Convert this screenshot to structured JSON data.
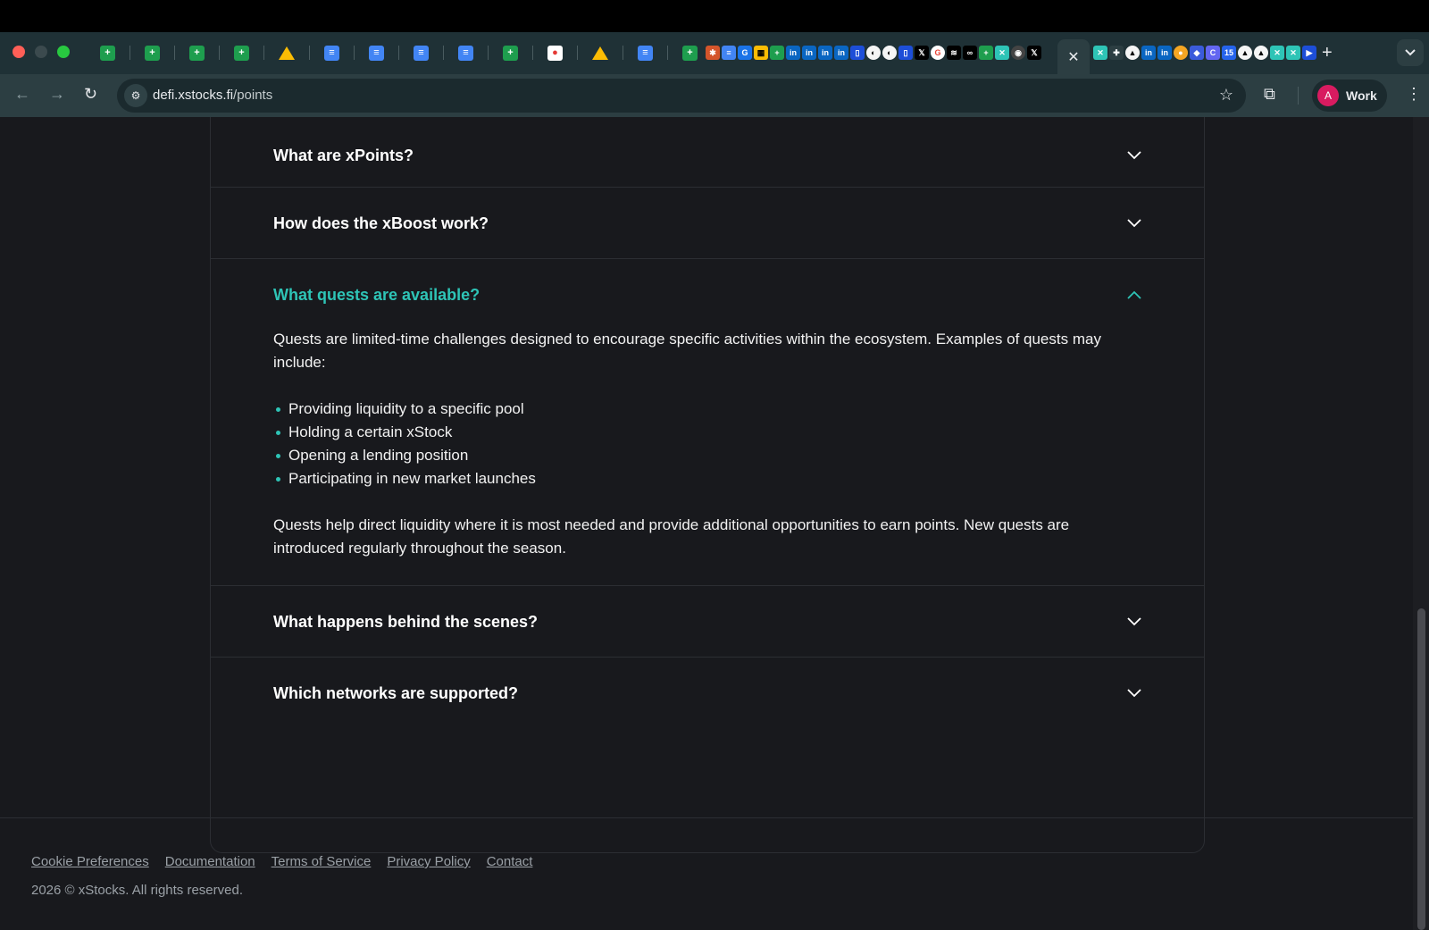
{
  "browser": {
    "active_tab_close": "✕",
    "new_tab": "+",
    "url_host": "defi.xstocks.fi",
    "url_path": "/points",
    "profile_initial": "A",
    "profile_name": "Work",
    "tab_favicons": [
      "sheets",
      "sheets",
      "sheets",
      "sheets",
      "drive",
      "docs",
      "docs",
      "docs",
      "docs",
      "sheets",
      "calendar",
      "drive",
      "docs",
      "sheets"
    ]
  },
  "faq": {
    "items": [
      {
        "question": "What are xPoints?",
        "expanded": false
      },
      {
        "question": "How does the xBoost work?",
        "expanded": false
      },
      {
        "question": "What quests are available?",
        "expanded": true,
        "answer_intro": "Quests are limited-time challenges designed to encourage specific activities within the ecosystem. Examples of quests may include:",
        "answer_bullets": [
          "Providing liquidity to a specific pool",
          "Holding a certain xStock",
          "Opening a lending position",
          "Participating in new market launches"
        ],
        "answer_outro": "Quests help direct liquidity where it is most needed and provide additional opportunities to earn points. New quests are introduced regularly throughout the season."
      },
      {
        "question": "What happens behind the scenes?",
        "expanded": false
      },
      {
        "question": "Which networks are supported?",
        "expanded": false
      }
    ]
  },
  "footer": {
    "links": [
      "Cookie Preferences",
      "Documentation",
      "Terms of Service",
      "Privacy Policy",
      "Contact"
    ],
    "copyright": "2026 © xStocks. All rights reserved."
  },
  "colors": {
    "accent": "#2ec4b6",
    "page_bg": "#18191d",
    "chrome_bg": "#1f3136"
  }
}
